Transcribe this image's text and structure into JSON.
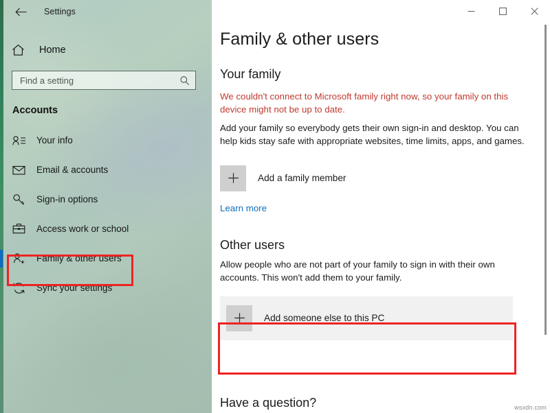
{
  "window": {
    "app_title": "Settings",
    "back_icon": "back-arrow-icon",
    "controls": {
      "minimize": "minimize-icon",
      "maximize": "maximize-icon",
      "close": "close-icon"
    }
  },
  "sidebar": {
    "home_label": "Home",
    "home_icon": "home-icon",
    "search": {
      "placeholder": "Find a setting",
      "value": "",
      "icon": "search-icon"
    },
    "category_heading": "Accounts",
    "items": [
      {
        "label": "Your info",
        "icon": "person-info-icon",
        "selected": false
      },
      {
        "label": "Email & accounts",
        "icon": "envelope-icon",
        "selected": false
      },
      {
        "label": "Sign-in options",
        "icon": "key-icon",
        "selected": false
      },
      {
        "label": "Access work or school",
        "icon": "briefcase-icon",
        "selected": false
      },
      {
        "label": "Family & other users",
        "icon": "person-add-icon",
        "selected": true
      },
      {
        "label": "Sync your settings",
        "icon": "sync-icon",
        "selected": false
      }
    ]
  },
  "main": {
    "page_title": "Family & other users",
    "your_family": {
      "heading": "Your family",
      "warning": "We couldn't connect to Microsoft family right now, so your family on this device might not be up to date.",
      "description": "Add your family so everybody gets their own sign-in and desktop. You can help kids stay safe with appropriate websites, time limits, apps, and games.",
      "add_button_label": "Add a family member",
      "add_button_icon": "plus-icon",
      "learn_more_label": "Learn more"
    },
    "other_users": {
      "heading": "Other users",
      "description": "Allow people who are not part of your family to sign in with their own accounts. This won't add them to your family.",
      "add_button_label": "Add someone else to this PC",
      "add_button_icon": "plus-icon"
    },
    "footer_heading": "Have a question?"
  },
  "annotations": {
    "color": "#ee2222",
    "boxes": [
      {
        "target": "sidebar-item-family-other-users"
      },
      {
        "target": "add-someone-else-row"
      }
    ]
  },
  "watermark": "wsxdn.com",
  "colors": {
    "accent_selection": "#0d6bc4",
    "warning_text": "#c0392f",
    "link": "#0f6cbd",
    "annotation": "#ee2222",
    "row_highlight": "#f1f1f1",
    "plus_box": "#cfcfcf"
  }
}
